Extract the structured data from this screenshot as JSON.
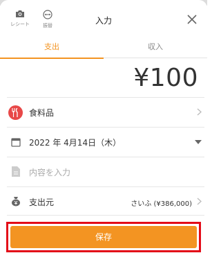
{
  "header": {
    "receipt_label": "レシート",
    "transfer_label": "振替",
    "title": "入力",
    "close_icon": "close-icon"
  },
  "tabs": [
    {
      "label": "支出",
      "active": true
    },
    {
      "label": "収入",
      "active": false
    }
  ],
  "amount": "¥100",
  "category": {
    "label": "食料品",
    "icon": "fork-knife-icon",
    "color": "#e84848"
  },
  "date": {
    "label": "2022 年 4月14日（木）",
    "icon": "calendar-icon"
  },
  "memo": {
    "placeholder": "内容を入力",
    "icon": "document-icon"
  },
  "source": {
    "label": "支出元",
    "value": "さいふ (¥386,000)",
    "icon": "wallet-icon"
  },
  "save_button": {
    "label": "保存"
  },
  "colors": {
    "accent": "#f39422",
    "highlight": "#e30b17"
  }
}
